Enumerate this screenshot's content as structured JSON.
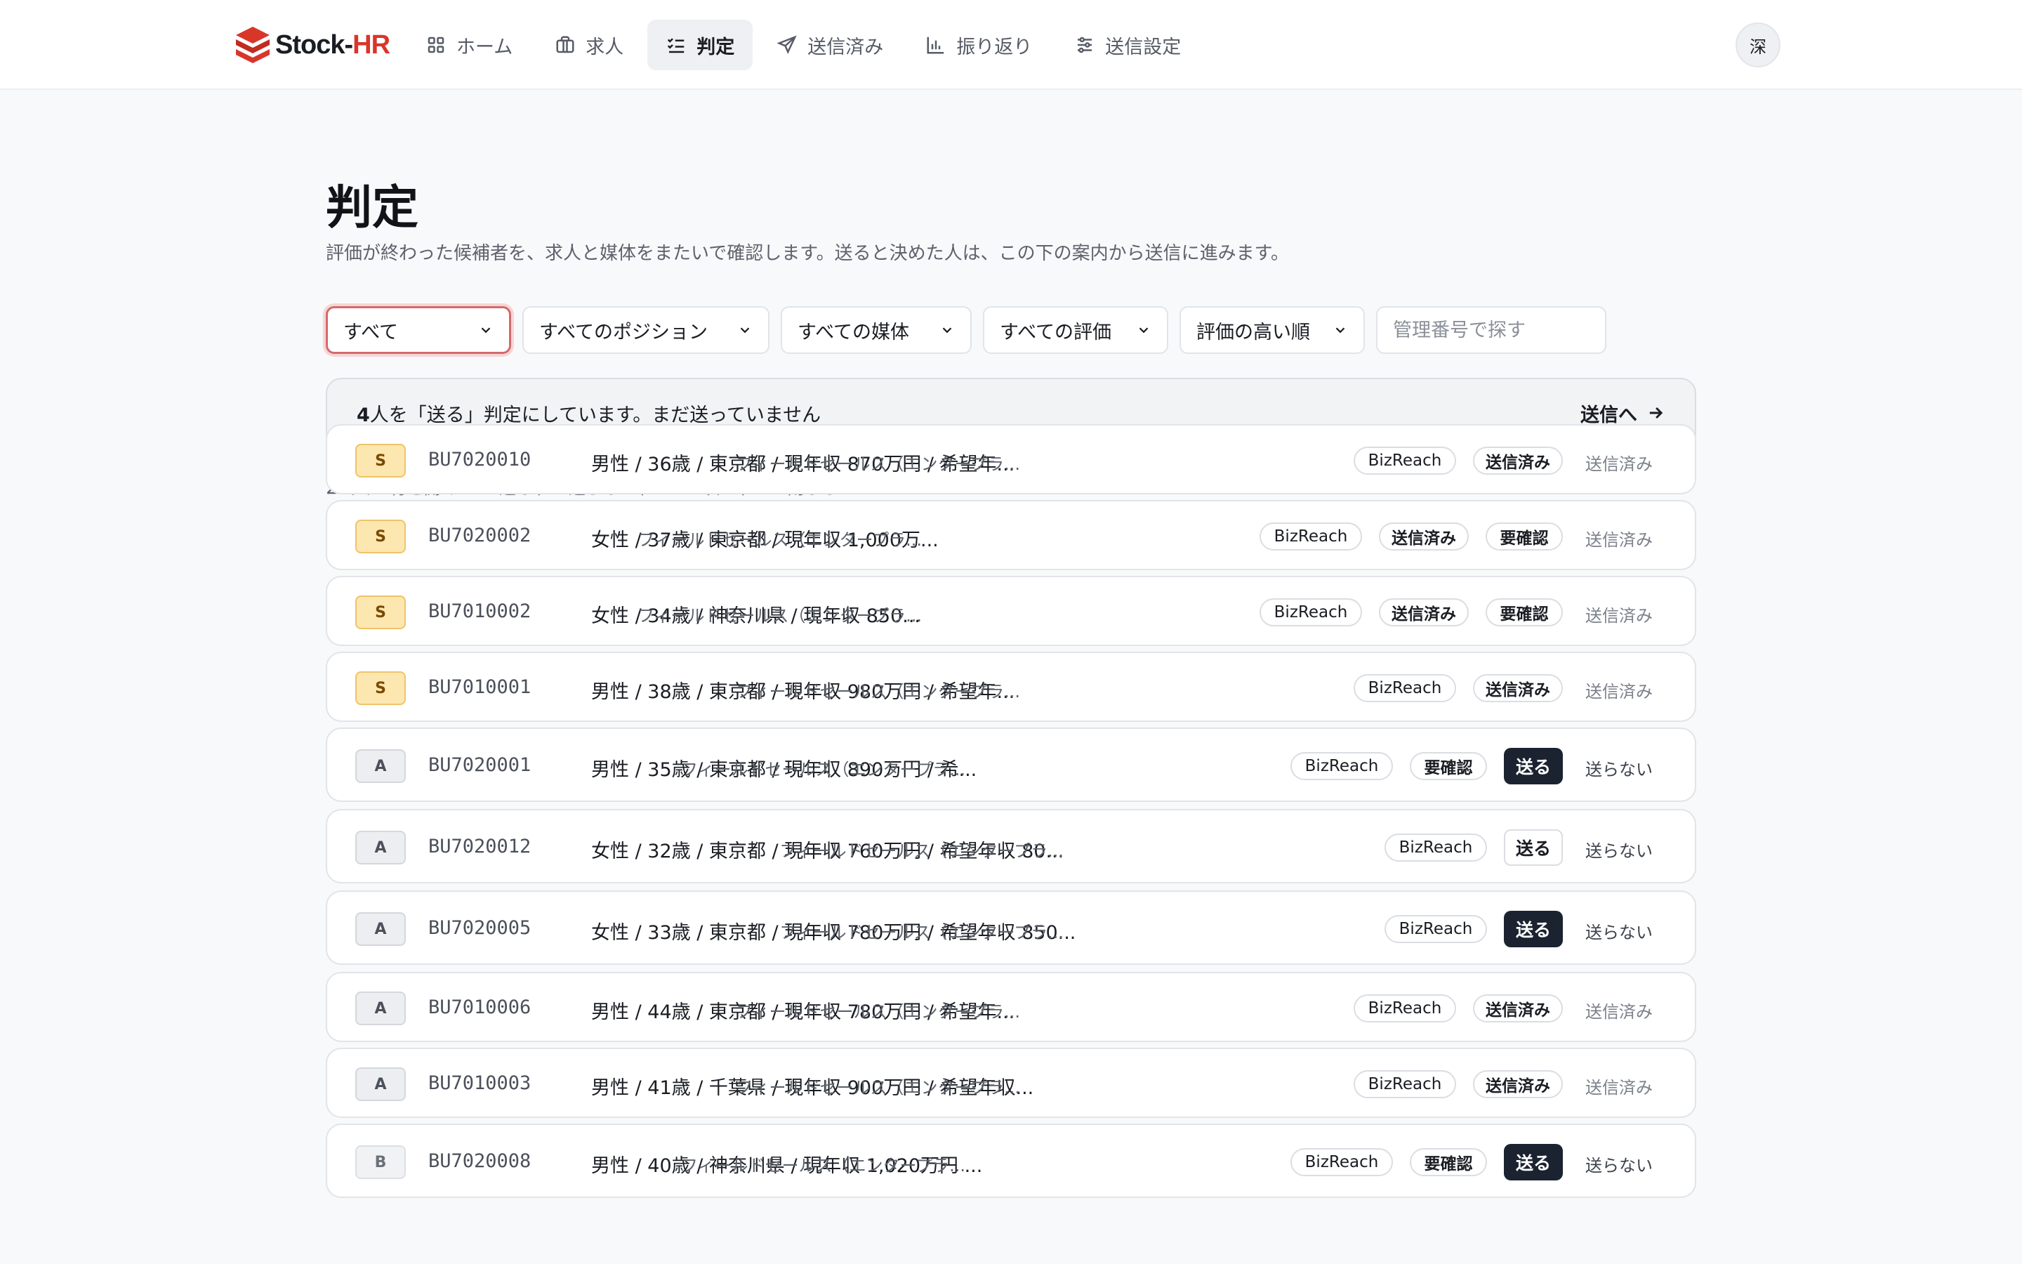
{
  "header": {
    "logo": {
      "brand": "Stock-",
      "accent": "HR"
    },
    "nav": [
      {
        "label": "ホーム",
        "icon": "grid-icon",
        "active": false
      },
      {
        "label": "求人",
        "icon": "briefcase-icon",
        "active": false
      },
      {
        "label": "判定",
        "icon": "checklist-icon",
        "active": true
      },
      {
        "label": "送信済み",
        "icon": "send-icon",
        "active": false
      },
      {
        "label": "振り返り",
        "icon": "bar-chart-icon",
        "active": false
      },
      {
        "label": "送信設定",
        "icon": "sliders-icon",
        "active": false
      }
    ],
    "avatar": "深"
  },
  "page": {
    "title": "判定",
    "description": "評価が終わった候補者を、求人と媒体をまたいで確認します。送ると決めた人は、この下の案内から送信に進みます。"
  },
  "filters": {
    "status": "すべて",
    "position": "すべてのポジション",
    "media": "すべての媒体",
    "rating": "すべての評価",
    "sort": "評価の高い順",
    "search_placeholder": "管理番号で探す"
  },
  "banner": {
    "count": "4",
    "text": "人を「送る」判定にしています。まだ送っていません",
    "link": "送信へ"
  },
  "list": {
    "count": "22人",
    "hint": "行を開くと → 送る / ← 送らない / Enter 次へ / Esc 閉じる"
  },
  "rows": [
    {
      "grade": "S",
      "id": "BU7020010",
      "summary": "男性 / 36歳 / 東京都 / 現年収 870万円 / 希望年...",
      "position": "フィールドセールス（エンタープラ...",
      "media": "BizReach",
      "tags": [
        "送信済み"
      ],
      "send": "",
      "status": "送信済み"
    },
    {
      "grade": "S",
      "id": "BU7020002",
      "summary": "女性 / 37歳 / 東京都 / 現年収 1,000万...",
      "position": "フィールドセールス（エンタープラ...",
      "media": "BizReach",
      "tags": [
        "送信済み",
        "要確認"
      ],
      "send": "",
      "status": "送信済み"
    },
    {
      "grade": "S",
      "id": "BU7010002",
      "summary": "女性 / 34歳 / 神奈川県 / 現年収 850...",
      "position": "フィールドセールス（エンタープラ...",
      "media": "BizReach",
      "tags": [
        "送信済み",
        "要確認"
      ],
      "send": "",
      "status": "送信済み"
    },
    {
      "grade": "S",
      "id": "BU7010001",
      "summary": "男性 / 38歳 / 東京都 / 現年収 980万円 / 希望年...",
      "position": "フィールドセールス（エンタープラ...",
      "media": "BizReach",
      "tags": [
        "送信済み"
      ],
      "send": "",
      "status": "送信済み"
    },
    {
      "grade": "A",
      "id": "BU7020001",
      "summary": "男性 / 35歳 / 東京都 / 現年収 890万円 / 希...",
      "position": "フィールドセールス（エンタープラ...",
      "media": "BizReach",
      "tags": [
        "要確認"
      ],
      "send": "送る",
      "status": "送らない"
    },
    {
      "grade": "A",
      "id": "BU7020012",
      "summary": "女性 / 32歳 / 東京都 / 現年収 760万円 / 希望年収 80...",
      "position": "フィールドセールス（エンタープラ...",
      "media": "BizReach",
      "tags": [],
      "send": "送る",
      "status": "送らない"
    },
    {
      "grade": "A",
      "id": "BU7020005",
      "summary": "女性 / 33歳 / 東京都 / 現年収 780万円 / 希望年収 850...",
      "position": "フィールドセールス（エンタープラ...",
      "media": "BizReach",
      "tags": [],
      "send": "送る",
      "status": "送らない"
    },
    {
      "grade": "A",
      "id": "BU7010006",
      "summary": "男性 / 44歳 / 東京都 / 現年収 780万円 / 希望年...",
      "position": "フィールドセールス（エンタープラ...",
      "media": "BizReach",
      "tags": [
        "送信済み"
      ],
      "send": "",
      "status": "送信済み"
    },
    {
      "grade": "A",
      "id": "BU7010003",
      "summary": "男性 / 41歳 / 千葉県 / 現年収 900万円 / 希望年収...",
      "position": "フィールドセールス（エンタープラ...",
      "media": "BizReach",
      "tags": [
        "送信済み"
      ],
      "send": "",
      "status": "送信済み"
    },
    {
      "grade": "B",
      "id": "BU7020008",
      "summary": "男性 / 40歳 / 神奈川県 / 現年収 1,020万円 ...",
      "position": "フィールドセールス（エンタープラ...",
      "media": "BizReach",
      "tags": [
        "要確認"
      ],
      "send": "送る",
      "status": "送らない"
    }
  ],
  "colors": {
    "accent": "#d9362a",
    "send_on": "#1b2230",
    "grade_s": "#fde7b0"
  }
}
